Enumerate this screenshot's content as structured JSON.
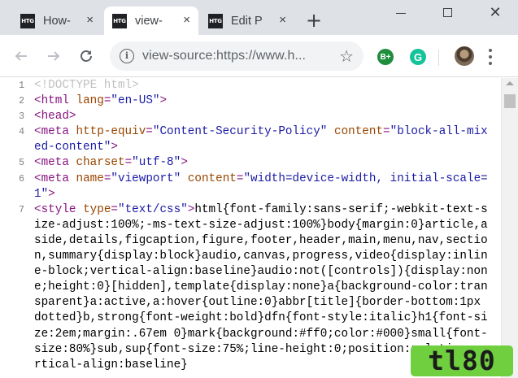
{
  "tabs": [
    {
      "favicon": "HTG",
      "title": "How-"
    },
    {
      "favicon": "HTG",
      "title": "view-"
    },
    {
      "favicon": "HTG",
      "title": "Edit P"
    }
  ],
  "tab_close_glyph": "×",
  "new_tab_glyph": "+",
  "window": {
    "close_glyph": "✕"
  },
  "toolbar": {
    "url": "view-source:https://www.h...",
    "star_glyph": "☆",
    "ext_b_label": "B+",
    "ext_g_label": "G"
  },
  "source": {
    "lines": [
      {
        "num": "1",
        "html": "<span class=\"doctype\">&lt;!DOCTYPE html&gt;</span>"
      },
      {
        "num": "2",
        "html": "<span class=\"tag\">&lt;html</span> <span class=\"attr\">lang</span><span class=\"tag\">=</span><span class=\"val\">\"en-US\"</span><span class=\"tag\">&gt;</span>"
      },
      {
        "num": "3",
        "html": "<span class=\"tag\">&lt;head&gt;</span>"
      },
      {
        "num": "",
        "html": "<span class=\"tag\">&lt;meta</span> <span class=\"attr\">http-equiv</span><span class=\"tag\">=</span><span class=\"val\">\"Content-Security-Policy\"</span> <span class=\"attr\">content</span><span class=\"tag\">=</span><span class=\"val\">\"block-all-mixed-content\"</span><span class=\"tag\">&gt;</span>"
      },
      {
        "num": "5",
        "html": "<span class=\"tag\">&lt;meta</span> <span class=\"attr\">charset</span><span class=\"tag\">=</span><span class=\"val\">\"utf-8\"</span><span class=\"tag\">&gt;</span>"
      },
      {
        "num": "6",
        "html": "<span class=\"tag\">&lt;meta</span> <span class=\"attr\">name</span><span class=\"tag\">=</span><span class=\"val\">\"viewport\"</span> <span class=\"attr\">content</span><span class=\"tag\">=</span><span class=\"val\">\"width=device-width, initial-scale=1\"</span><span class=\"tag\">&gt;</span>"
      },
      {
        "num": "7",
        "html": "<span class=\"tag\">&lt;style</span> <span class=\"attr\">type</span><span class=\"tag\">=</span><span class=\"val\">\"text/css\"</span><span class=\"tag\">&gt;</span><span class=\"txt\">html{font-family:sans-serif;-webkit-text-size-adjust:100%;-ms-text-size-adjust:100%}body{margin:0}article,aside,details,figcaption,figure,footer,header,main,menu,nav,section,summary{display:block}audio,canvas,progress,video{display:inline-block;vertical-align:baseline}audio:not([controls]){display:none;height:0}[hidden],template{display:none}a{background-color:transparent}a:active,a:hover{outline:0}abbr[title]{border-bottom:1px dotted}b,strong{font-weight:bold}dfn{font-style:italic}h1{font-size:2em;margin:.67em 0}mark{background:#ff0;color:#000}small{font-size:80%}sub,sup{font-size:75%;line-height:0;position:relative;vertical-align:baseline}</span>"
      }
    ]
  },
  "watermark": "tl80"
}
